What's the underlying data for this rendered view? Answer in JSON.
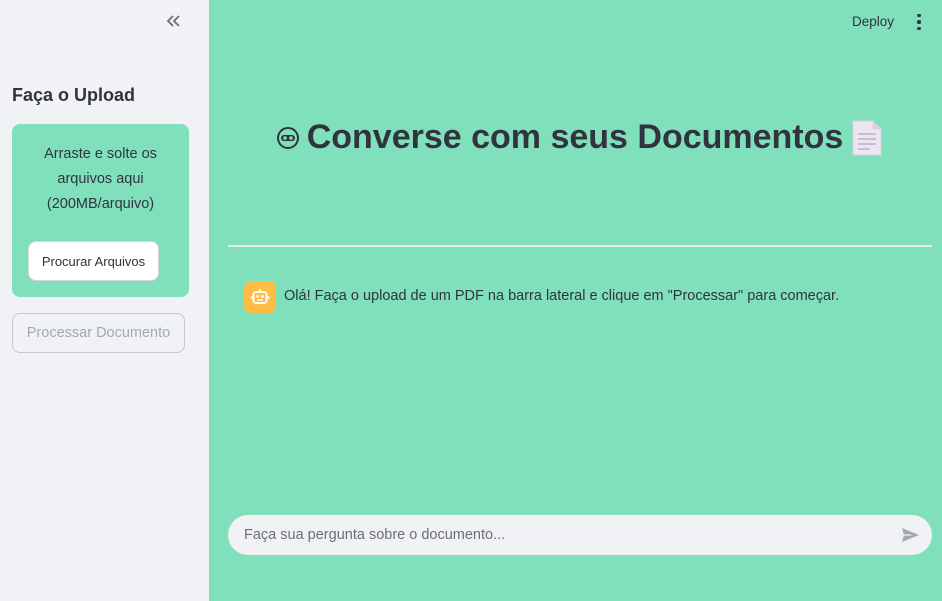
{
  "sidebar": {
    "title": "Faça o Upload",
    "dropzone_text": "Arraste e solte os arquivos aqui (200MB/arquivo)",
    "browse_label": "Procurar Arquivos",
    "process_label": "Processar Documento",
    "collapse_icon": "double-chevron-left-icon"
  },
  "header": {
    "deploy_label": "Deploy",
    "menu_icon": "vertical-dots-icon"
  },
  "main": {
    "title": "Converse com seus Documentos",
    "title_icon_left": "mask-face-icon",
    "title_icon_right": "page-document-icon",
    "message": {
      "avatar_icon": "robot-icon",
      "text": "Olá! Faça o upload de um PDF na barra lateral e clique em \"Processar\" para começar."
    },
    "chat_input": {
      "placeholder": "Faça sua pergunta sobre o documento...",
      "value": "",
      "send_icon": "send-arrow-icon"
    }
  },
  "colors": {
    "background": "#80e0bb",
    "sidebar": "#f0f2f6",
    "avatar": "#ffbd45",
    "text": "#31333f"
  }
}
